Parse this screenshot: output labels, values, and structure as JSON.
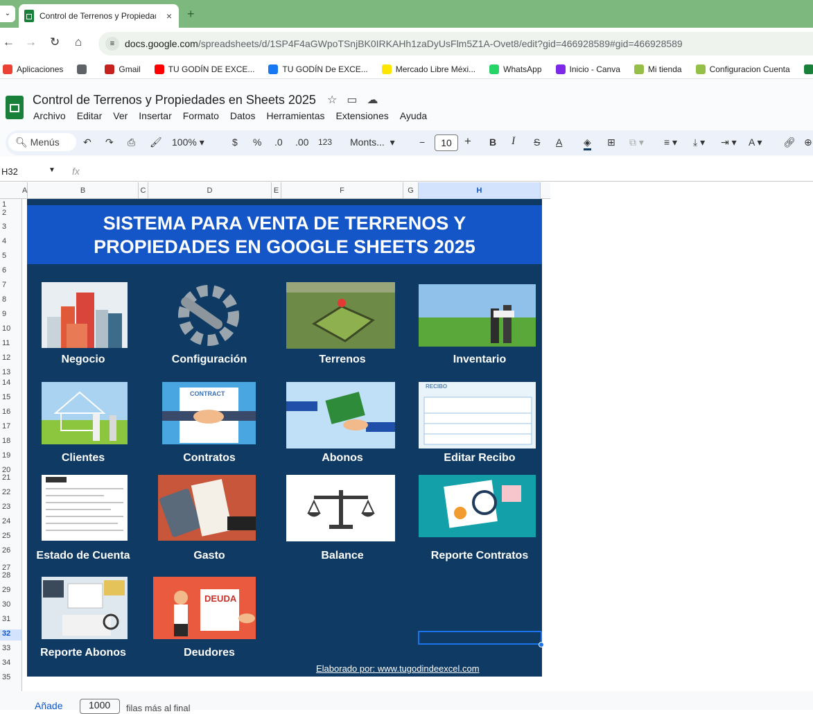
{
  "browser": {
    "tab_title": "Control de Terrenos y Propiedad",
    "tab_close": "×",
    "new_tab": "+",
    "url_domain": "docs.google.com",
    "url_path": "/spreadsheets/d/1SP4F4aGWpoTSnjBK0IRKAHh1zaDyUsFlm5Z1A-Ovet8/edit?gid=466928589#gid=466928589",
    "bookmarks": [
      {
        "label": "Aplicaciones",
        "color": "#ea4335"
      },
      {
        "label": "",
        "color": "#5f6368"
      },
      {
        "label": "Gmail",
        "color": "#c5221f"
      },
      {
        "label": "TU GODÍN DE EXCE...",
        "color": "#ff0000"
      },
      {
        "label": "TU GODÍN De EXCE...",
        "color": "#1877f2"
      },
      {
        "label": "Mercado Libre Méxi...",
        "color": "#ffe600"
      },
      {
        "label": "WhatsApp",
        "color": "#25d366"
      },
      {
        "label": "Inicio - Canva",
        "color": "#7d2ae8"
      },
      {
        "label": "Mi tienda",
        "color": "#95bf47"
      },
      {
        "label": "Configuracion Cuenta",
        "color": "#95bf47"
      },
      {
        "label": "TU G",
        "color": "#188038"
      }
    ]
  },
  "doc": {
    "title": "Control de Terrenos y Propiedades en Sheets 2025",
    "menu": [
      "Archivo",
      "Editar",
      "Ver",
      "Insertar",
      "Formato",
      "Datos",
      "Herramientas",
      "Extensiones",
      "Ayuda"
    ]
  },
  "toolbar": {
    "search_label": "Menús",
    "zoom": "100%",
    "currency": "$",
    "percent": "%",
    "dec_less": ".0",
    "dec_more": ".00",
    "format_123": "123",
    "font": "Monts...",
    "font_size": "10",
    "minus": "−",
    "plus": "+",
    "bold": "B",
    "italic": "I",
    "strike": "S",
    "text_color": "A"
  },
  "formula_bar": {
    "name_box": "H32",
    "fx": "fx"
  },
  "grid": {
    "columns": [
      "A",
      "B",
      "C",
      "D",
      "E",
      "F",
      "G",
      "H"
    ],
    "selected_column": "H",
    "rows": [
      "1",
      "2",
      "3",
      "4",
      "5",
      "6",
      "7",
      "8",
      "9",
      "10",
      "11",
      "12",
      "13",
      "14",
      "15",
      "16",
      "17",
      "18",
      "19",
      "20",
      "21",
      "22",
      "23",
      "24",
      "25",
      "26",
      "27",
      "28",
      "29",
      "30",
      "31",
      "32",
      "33",
      "34",
      "35"
    ],
    "selected_row": "32"
  },
  "dashboard": {
    "banner_line1": "SISTEMA PARA VENTA DE TERRENOS Y",
    "banner_line2": "PROPIEDADES EN GOOGLE SHEETS 2025",
    "cards": [
      {
        "label": "Negocio",
        "icon": "buildings-icon"
      },
      {
        "label": "Configuración",
        "icon": "gear-wrench-icon"
      },
      {
        "label": "Terrenos",
        "icon": "land-plot-icon"
      },
      {
        "label": "Inventario",
        "icon": "field-people-icon"
      },
      {
        "label": "Clientes",
        "icon": "house-couple-icon"
      },
      {
        "label": "Contratos",
        "icon": "contract-handshake-icon"
      },
      {
        "label": "Abonos",
        "icon": "money-hand-icon"
      },
      {
        "label": "Editar Recibo",
        "icon": "receipt-icon"
      },
      {
        "label": "Estado de Cuenta",
        "icon": "statement-icon"
      },
      {
        "label": "Gasto",
        "icon": "calculator-bill-icon"
      },
      {
        "label": "Balance",
        "icon": "scale-icon"
      },
      {
        "label": "Reporte Contratos",
        "icon": "report-magnifier-icon"
      },
      {
        "label": "Reporte Abonos",
        "icon": "report-desk-icon"
      },
      {
        "label": "Deudores",
        "icon": "debt-man-icon"
      }
    ],
    "deuda_text": "DEUDA",
    "contract_text": "CONTRACT",
    "recibo_text": "RECIBO",
    "credit": "Elaborado por: www.tugodindeexcel.com"
  },
  "footer": {
    "add_label": "Añade",
    "rows_value": "1000",
    "rows_after": "filas más al final"
  }
}
